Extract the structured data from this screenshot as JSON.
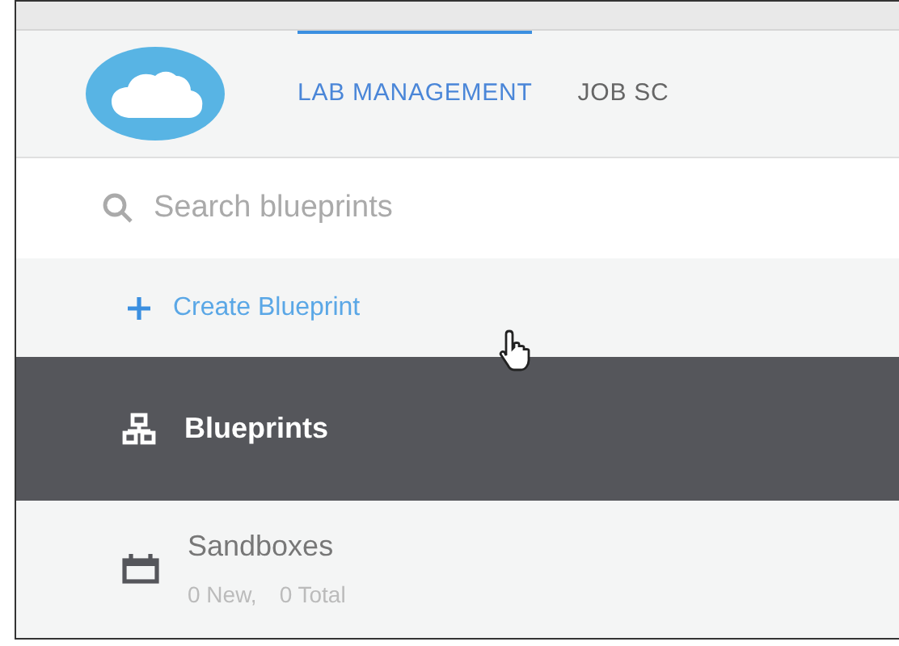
{
  "tabs": [
    {
      "label": "LAB MANAGEMENT",
      "selected": true
    },
    {
      "label": "JOB SC",
      "selected": false
    }
  ],
  "search": {
    "placeholder": "Search blueprints"
  },
  "create_button": {
    "label": "Create Blueprint"
  },
  "nav_items": [
    {
      "kind": "blueprints",
      "label": "Blueprints",
      "selected": true
    },
    {
      "kind": "sandboxes",
      "label": "Sandboxes",
      "subtitle": [
        "0 New,",
        "0 Total"
      ],
      "selected": false
    }
  ]
}
